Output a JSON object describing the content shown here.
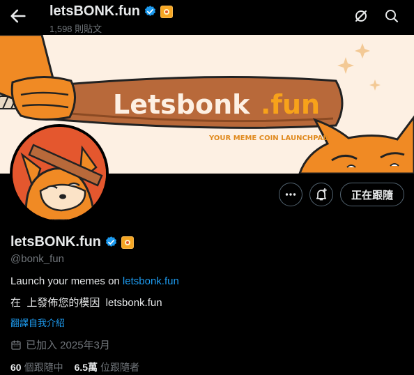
{
  "header": {
    "title": "letsBONK.fun",
    "post_count": "1,598 則貼文"
  },
  "banner": {
    "brand_main": "Letsbonk",
    "brand_tld": ".fun",
    "tagline": "YOUR MEME COIN LAUNCHPAD"
  },
  "actions": {
    "follow_label": "正在跟隨"
  },
  "profile": {
    "name": "letsBONK.fun",
    "handle": "@bonk_fun",
    "bio_line1_prefix": "Launch your memes on ",
    "bio_line1_link": "letsbonk.fun",
    "bio_line2": "在  上發佈您的模因  letsbonk.fun",
    "translate_label": "翻譯自我介紹",
    "joined": "已加入 2025年3月"
  },
  "stats": {
    "following_count": "60",
    "following_label": "個跟隨中",
    "followers_count": "6.5萬",
    "followers_label": "位跟隨者"
  },
  "colors": {
    "accent": "#1d9bf0",
    "verified": "#1d9bf0",
    "affiliate": "#f5a623",
    "banner_bg": "#fdf0e3",
    "bat": "#b8693a",
    "dog": "#f08a24"
  }
}
